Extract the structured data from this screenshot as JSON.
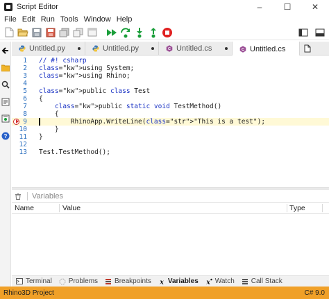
{
  "window": {
    "title": "Script Editor",
    "controls": [
      "–",
      "☐",
      "✕"
    ]
  },
  "menu": [
    "File",
    "Edit",
    "Run",
    "Tools",
    "Window",
    "Help"
  ],
  "tabs": [
    {
      "label": "Untitled.py",
      "icon": "python-icon",
      "modified": true,
      "active": false
    },
    {
      "label": "Untitled.py",
      "icon": "python-icon",
      "modified": true,
      "active": false
    },
    {
      "label": "Untitled.cs",
      "icon": "csharp-icon",
      "modified": true,
      "active": false
    },
    {
      "label": "Untitled.cs",
      "icon": "csharp-icon",
      "modified": false,
      "active": true
    }
  ],
  "code": {
    "lines": [
      {
        "n": "1",
        "text": "// #! csharp"
      },
      {
        "n": "2",
        "text": "using System;"
      },
      {
        "n": "3",
        "text": "using Rhino;"
      },
      {
        "n": "4",
        "text": ""
      },
      {
        "n": "5",
        "text": "public class Test"
      },
      {
        "n": "6",
        "text": "{"
      },
      {
        "n": "7",
        "text": "    public static void TestMethod()"
      },
      {
        "n": "8",
        "text": "    {"
      },
      {
        "n": "9",
        "text": "        RhinoApp.WriteLine(\"This is a test\");"
      },
      {
        "n": "10",
        "text": "    }"
      },
      {
        "n": "11",
        "text": "}"
      },
      {
        "n": "12",
        "text": ""
      },
      {
        "n": "13",
        "text": "Test.TestMethod();"
      }
    ],
    "current_line": "9",
    "breakpoint_line": "9"
  },
  "panel": {
    "title": "Variables",
    "columns": [
      "Name",
      "Value",
      "Type"
    ]
  },
  "bottom_tabs": [
    {
      "label": "Terminal",
      "icon": "terminal-icon"
    },
    {
      "label": "Problems",
      "icon": "problems-icon"
    },
    {
      "label": "Breakpoints",
      "icon": "breakpoints-icon"
    },
    {
      "label": "Variables",
      "icon": "variables-icon",
      "active": true
    },
    {
      "label": "Watch",
      "icon": "watch-icon"
    },
    {
      "label": "Call Stack",
      "icon": "call-stack-icon"
    }
  ],
  "status": {
    "left": "Rhino3D Project",
    "right": "C# 9.0"
  },
  "colors": {
    "status_bar": "#f0a028",
    "run_green": "#1a9e3a",
    "stop_red": "#e02020",
    "keyword": "#1a33c4",
    "string": "#a31515"
  }
}
